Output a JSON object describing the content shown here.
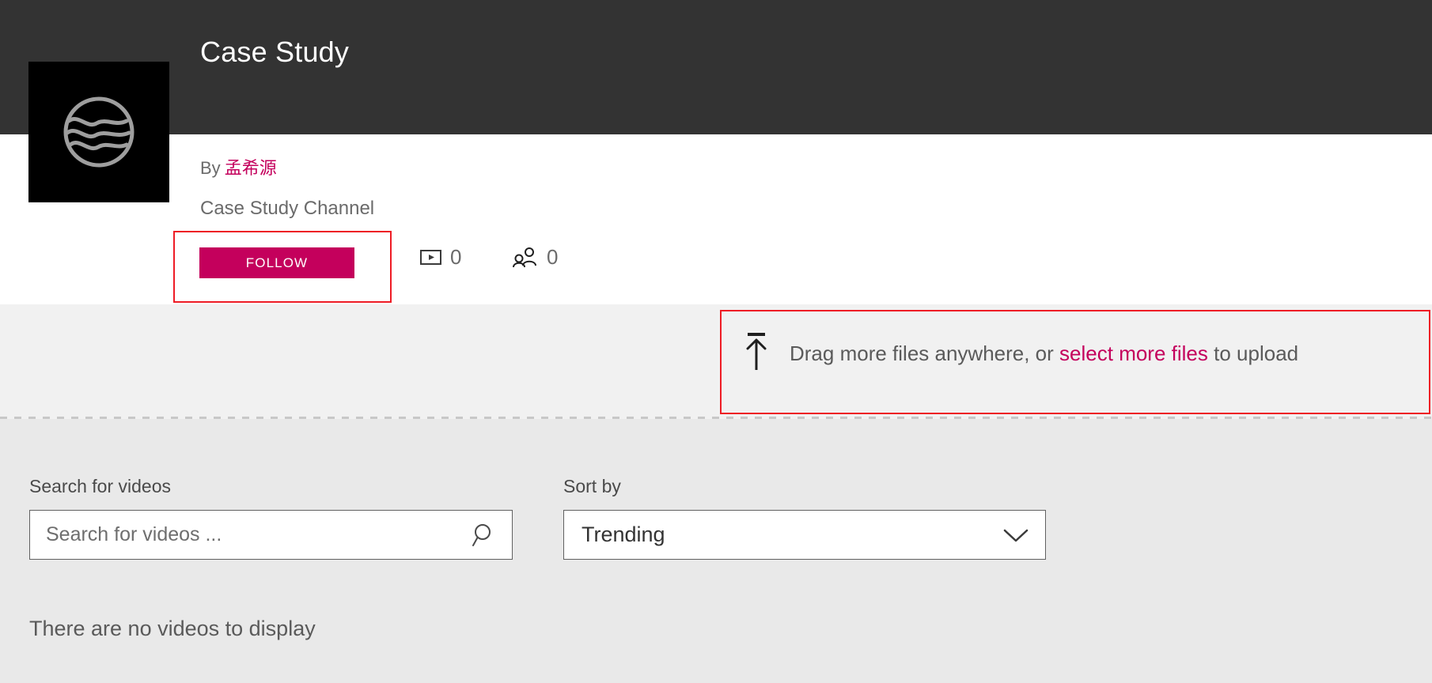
{
  "header": {
    "title": "Case Study",
    "background_color": "#333333",
    "logo_icon": "stream-wave-circle-icon"
  },
  "channel": {
    "by_label": "By",
    "author": "孟希源",
    "author_color": "#c4005c",
    "name": "Case Study Channel",
    "follow_button": {
      "label": "FOLLOW",
      "background_color": "#c4005c",
      "text_color": "#ffffff"
    },
    "stats": [
      {
        "icon": "video-count-icon",
        "value": "0",
        "name": "videos"
      },
      {
        "icon": "followers-people-icon",
        "value": "0",
        "name": "followers"
      }
    ]
  },
  "upload": {
    "icon": "upload-arrow-icon",
    "text_before": "Drag more files anywhere, or",
    "link_text": "select more files",
    "text_after": "to upload",
    "link_color": "#c4005c",
    "band_color": "#f1f1f1"
  },
  "filters": {
    "search_label": "Search for videos",
    "search_placeholder": "Search for videos ...",
    "search_value": "",
    "search_icon": "search-magnifier-icon",
    "sort_label": "Sort by",
    "sort_value": "Trending",
    "sort_icon": "chevron-down-icon",
    "sort_options": [
      "Trending"
    ]
  },
  "results": {
    "empty_message": "There are no videos to display"
  },
  "annotations": {
    "highlight_color": "#ee1c25",
    "boxes": [
      "follow-button-highlight",
      "upload-banner-highlight"
    ]
  }
}
